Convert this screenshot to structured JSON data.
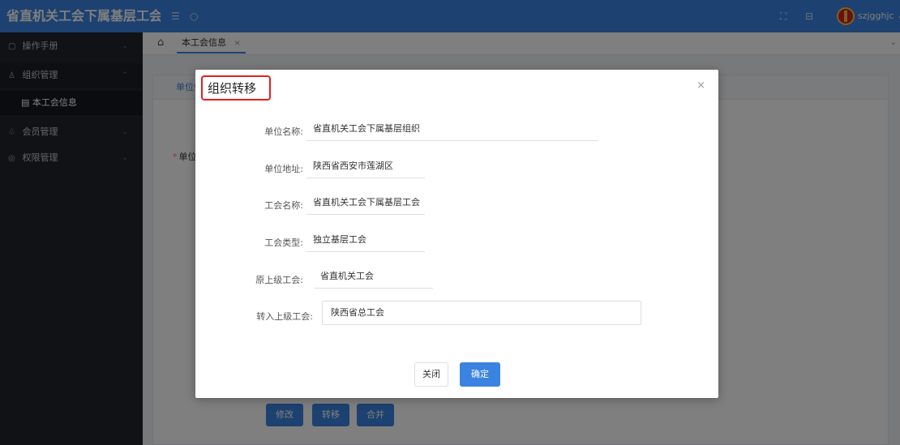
{
  "header": {
    "app_title": "省直机关工会下属基层工会",
    "menu_icon": "menu-fold-icon",
    "refresh_icon": "refresh-icon",
    "fullscreen_icon": "fullscreen-icon",
    "lock_icon": "lock-icon",
    "logo": "union-logo",
    "username": "szjgghjc ⌄"
  },
  "sidebar": {
    "items": [
      {
        "icon": "file-icon",
        "label": "操作手册"
      },
      {
        "icon": "org-icon",
        "label": "组织管理"
      },
      {
        "icon": "users-icon",
        "label": "会员管理"
      },
      {
        "icon": "shield-icon",
        "label": "权限管理"
      }
    ],
    "subitems": [
      {
        "icon": "doc-icon",
        "label": "本工会信息"
      }
    ]
  },
  "tabs": {
    "home_icon": "home-icon",
    "items": [
      {
        "label": "本工会信息",
        "close": "×"
      }
    ]
  },
  "page": {
    "card_header_label": "单位信息",
    "field_label": "单位名称",
    "required_mark": "*",
    "buttons": {
      "edit": "修改",
      "transfer": "转移",
      "merge": "合并"
    }
  },
  "modal": {
    "title": "组织转移",
    "close_icon": "×",
    "fields": [
      {
        "label": "单位名称:",
        "value": "省直机关工会下属基层组织"
      },
      {
        "label": "单位地址:",
        "value": "陕西省西安市莲湖区"
      },
      {
        "label": "工会名称:",
        "value": "省直机关工会下属基层工会"
      },
      {
        "label": "工会类型:",
        "value": "独立基层工会"
      },
      {
        "label": "原上级工会:",
        "value": "省直机关工会"
      },
      {
        "label": "转入上级工会:",
        "value": "陕西省总工会"
      }
    ],
    "buttons": {
      "cancel": "关闭",
      "confirm": "确定"
    }
  },
  "colors": {
    "brand": "#3b83e0",
    "sidebar": "#20242d",
    "highlight": "#e02020"
  }
}
